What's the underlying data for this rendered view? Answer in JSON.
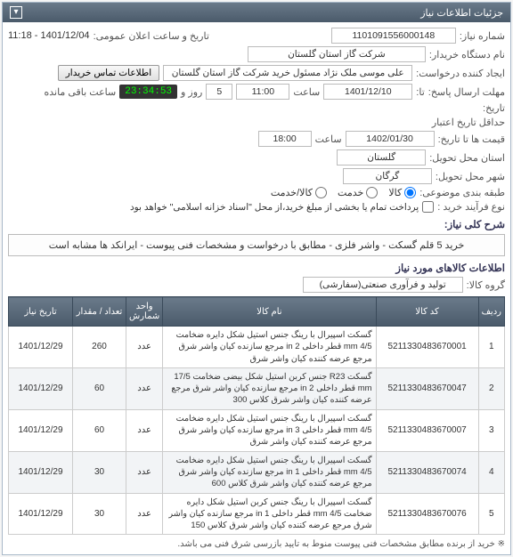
{
  "panel": {
    "title": "جزئیات اطلاعات نیاز",
    "toggle_glyph": "▾"
  },
  "header": {
    "need_no_label": "شماره نیاز:",
    "need_no": "1101091556000148",
    "announce_label": "تاریخ و ساعت اعلان عمومی:",
    "announce_value": "1401/12/04 - 11:18",
    "buyer_org_label": "نام دستگاه خریدار:",
    "buyer_org": "شرکت گاز استان گلستان",
    "requester_label": "ایجاد کننده درخواست:",
    "requester": "علی موسی ملک نژاد مسئول خرید شرکت گاز استان گلستان",
    "contact_btn": "اطلاعات تماس خریدار",
    "send_deadline_label": "مهلت ارسال پاسخ:",
    "until_label": "تا:",
    "date_field": "1401/12/10",
    "time_label": "ساعت",
    "time_field": "11:00",
    "remain_days": "5",
    "days_and_label": "روز و",
    "countdown": "23:34:53",
    "remain_suffix": "ساعت باقی مانده",
    "history_label": "تاریخ:",
    "min_valid_label": "حداقل تاریخ اعتبار",
    "quote_until_label": "قیمت ها تا تاریخ:",
    "valid_date": "1402/01/30",
    "valid_time": "18:00",
    "province_label": "استان محل تحویل:",
    "province": "گلستان",
    "city_label": "شهر محل تحویل:",
    "city": "گرگان",
    "subject_count_label": "طبقه بندی موضوعی:",
    "radio_goods": "کالا",
    "radio_service": "خدمت",
    "radio_both": "کالا/خدمت",
    "process_label": "نوع فرآیند خرید :",
    "prepay_text": "پرداخت تمام یا بخشی از مبلغ خرید،از محل \"اسناد خزانه اسلامی\" خواهد بود"
  },
  "description": {
    "title": "شرح کلی نیاز:",
    "text": "خرید 5 قلم گسکت - واشر فلزی - مطابق با درخواست و مشخصات فنی پیوست - ایرانکد ها مشابه است"
  },
  "goods": {
    "title": "اطلاعات کالاهای مورد نیاز",
    "group_label": "گروه کالا:",
    "group_value": "تولید و فرآوری صنعتی(سفارشی)",
    "columns": {
      "row": "ردیف",
      "code": "کد کالا",
      "name": "نام کالا",
      "unit": "واحد شمارش",
      "qty": "تعداد / مقدار",
      "date": "تاریخ نیاز"
    },
    "rows": [
      {
        "idx": "1",
        "code": "5211330483670001",
        "name": "گسکت اسپیرال با رینگ جنس استیل شکل دایره ضخامت 4/5 mm قطر داخلی 2 in مرجع سازنده کیان واشر شرق مرجع عرضه کننده کیان واشر شرق",
        "unit": "عدد",
        "qty": "260",
        "date": "1401/12/29"
      },
      {
        "idx": "2",
        "code": "5211330483670047",
        "name": "گسکت R23 جنس کربن استیل شکل بیضی ضخامت 17/5 mm قطر داخلی 2 in مرجع سازنده کیان واشر شرق مرجع عرضه کننده کیان واشر شرق کلاس 300",
        "unit": "عدد",
        "qty": "60",
        "date": "1401/12/29"
      },
      {
        "idx": "3",
        "code": "5211330483670007",
        "name": "گسکت اسپیرال با رینگ جنس استیل شکل دایره ضخامت 4/5 mm قطر داخلی 3 in مرجع سازنده کیان واشر شرق مرجع عرضه کننده کیان واشر شرق",
        "unit": "عدد",
        "qty": "60",
        "date": "1401/12/29"
      },
      {
        "idx": "4",
        "code": "5211330483670074",
        "name": "گسکت اسپیرال با رینگ جنس استیل شکل دایره ضخامت 4/5 mm قطر داخلی 1 in مرجع سازنده کیان واشر شرق مرجع عرضه کننده کیان واشر شرق کلاس 600",
        "unit": "عدد",
        "qty": "30",
        "date": "1401/12/29"
      },
      {
        "idx": "5",
        "code": "5211330483670076",
        "name": "گسکت اسپیرال با رینگ جنس کربن استیل شکل دایره ضخامت 4/5 mm قطر داخلی 1 in مرجع سازنده کیان واشر شرق مرجع عرضه کننده کیان واشر شرق کلاس 150",
        "unit": "عدد",
        "qty": "30",
        "date": "1401/12/29"
      }
    ]
  },
  "footnote": "※ خرید از برنده مطابق مشخصات فنی پیوست منوط به تایید بازرسی شرق فنی می باشد."
}
